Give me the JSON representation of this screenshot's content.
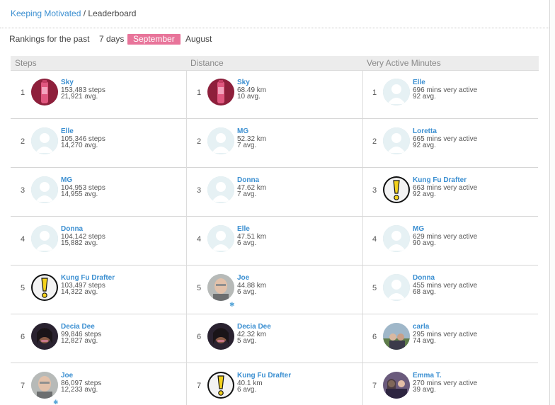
{
  "breadcrumb": {
    "link": "Keeping Motivated",
    "separator": " / ",
    "current": "Leaderboard"
  },
  "filters": {
    "label": "Rankings for the past",
    "options": [
      "7 days",
      "September",
      "August"
    ],
    "active": "September"
  },
  "columns": [
    {
      "header": "Steps",
      "rows": [
        {
          "rank": "1",
          "name": "Sky",
          "primary": "153,483 steps",
          "secondary": "21,921 avg.",
          "avatar": "pink-bottle"
        },
        {
          "rank": "2",
          "name": "Elle",
          "primary": "105,346 steps",
          "secondary": "14,270 avg.",
          "avatar": "default"
        },
        {
          "rank": "3",
          "name": "MG",
          "primary": "104,953 steps",
          "secondary": "14,955 avg.",
          "avatar": "default"
        },
        {
          "rank": "4",
          "name": "Donna",
          "primary": "104,142 steps",
          "secondary": "15,882 avg.",
          "avatar": "default"
        },
        {
          "rank": "5",
          "name": "Kung Fu Drafter",
          "primary": "103,497 steps",
          "secondary": "14,322 avg.",
          "avatar": "exclaim"
        },
        {
          "rank": "6",
          "name": "Decia Dee",
          "primary": "99,846 steps",
          "secondary": "12,827 avg.",
          "avatar": "woman"
        },
        {
          "rank": "7",
          "name": "Joe",
          "primary": "86,097 steps",
          "secondary": "12,233 avg.",
          "avatar": "man",
          "badge": "fitbit-icon"
        }
      ]
    },
    {
      "header": "Distance",
      "rows": [
        {
          "rank": "1",
          "name": "Sky",
          "primary": "68.49 km",
          "secondary": "10 avg.",
          "avatar": "pink-bottle"
        },
        {
          "rank": "2",
          "name": "MG",
          "primary": "52.32 km",
          "secondary": "7 avg.",
          "avatar": "default"
        },
        {
          "rank": "3",
          "name": "Donna",
          "primary": "47.62 km",
          "secondary": "7 avg.",
          "avatar": "default"
        },
        {
          "rank": "4",
          "name": "Elle",
          "primary": "47.51 km",
          "secondary": "6 avg.",
          "avatar": "default"
        },
        {
          "rank": "5",
          "name": "Joe",
          "primary": "44.88 km",
          "secondary": "6 avg.",
          "avatar": "man",
          "badge": "fitbit-icon"
        },
        {
          "rank": "6",
          "name": "Decia Dee",
          "primary": "42.32 km",
          "secondary": "5 avg.",
          "avatar": "woman"
        },
        {
          "rank": "7",
          "name": "Kung Fu Drafter",
          "primary": "40.1 km",
          "secondary": "6 avg.",
          "avatar": "exclaim"
        }
      ]
    },
    {
      "header": "Very Active Minutes",
      "rows": [
        {
          "rank": "1",
          "name": "Elle",
          "primary": "696 mins very active",
          "secondary": "92 avg.",
          "avatar": "default"
        },
        {
          "rank": "2",
          "name": "Loretta",
          "primary": "665 mins very active",
          "secondary": "92 avg.",
          "avatar": "default"
        },
        {
          "rank": "3",
          "name": "Kung Fu Drafter",
          "primary": "663 mins very active",
          "secondary": "92 avg.",
          "avatar": "exclaim"
        },
        {
          "rank": "4",
          "name": "MG",
          "primary": "629 mins very active",
          "secondary": "90 avg.",
          "avatar": "default"
        },
        {
          "rank": "5",
          "name": "Donna",
          "primary": "455 mins very active",
          "secondary": "68 avg.",
          "avatar": "default"
        },
        {
          "rank": "6",
          "name": "carla",
          "primary": "295 mins very active",
          "secondary": "74 avg.",
          "avatar": "outdoor"
        },
        {
          "rank": "7",
          "name": "Emma T.",
          "primary": "270 mins very active",
          "secondary": "39 avg.",
          "avatar": "group"
        }
      ]
    }
  ]
}
